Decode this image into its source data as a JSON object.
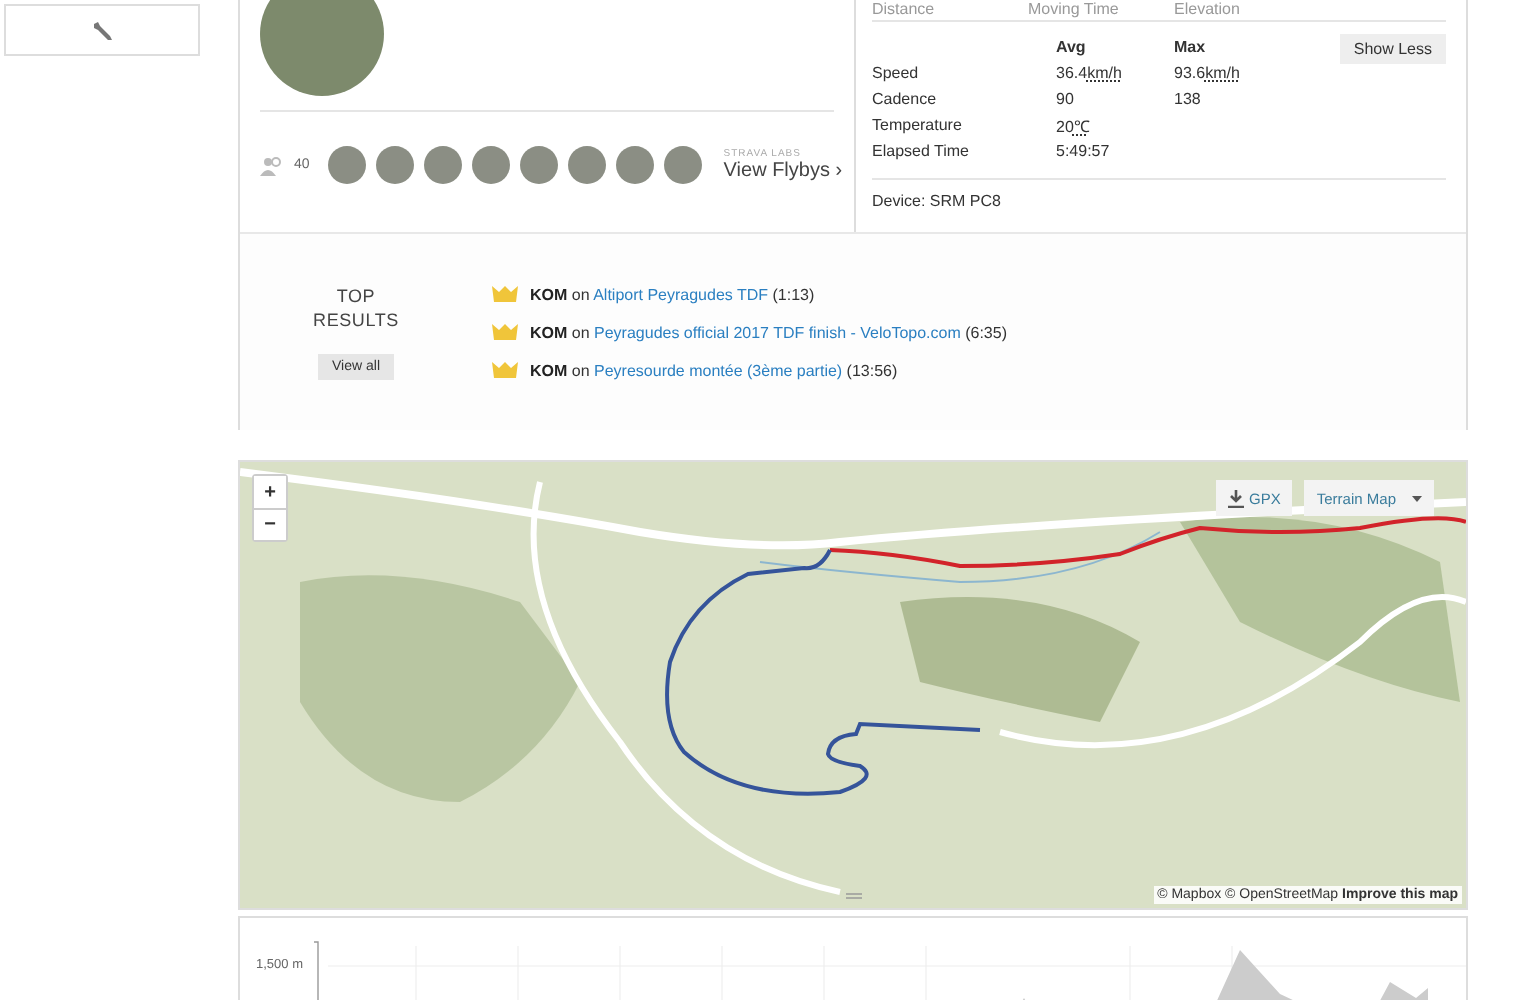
{
  "activity": {
    "athletes_count": "40",
    "labs_label": "STRAVA LABS",
    "flybys_link": "View Flybys",
    "flybys_chevron": "›"
  },
  "stats": {
    "summary_labels": [
      "Distance",
      "Moving Time",
      "Elevation"
    ],
    "columns": [
      "Avg",
      "Max"
    ],
    "rows": [
      {
        "label": "Speed",
        "avg": "36.4",
        "avg_unit": "km/h",
        "max": "93.6",
        "max_unit": "km/h"
      },
      {
        "label": "Cadence",
        "avg": "90",
        "avg_unit": "",
        "max": "138",
        "max_unit": ""
      },
      {
        "label": "Temperature",
        "avg": "20",
        "avg_unit": "℃",
        "max": "",
        "max_unit": ""
      },
      {
        "label": "Elapsed Time",
        "avg": "5:49:57",
        "avg_unit": "",
        "max": "",
        "max_unit": ""
      }
    ],
    "toggle_button": "Show Less",
    "device": "Device: SRM PC8"
  },
  "top_results": {
    "title_line1": "TOP",
    "title_line2": "RESULTS",
    "view_all": "View all",
    "items": [
      {
        "kind": "kom",
        "achievement": "KOM",
        "joiner": "on",
        "segment": "Altiport Peyragudes TDF",
        "time": "(1:13)"
      },
      {
        "kind": "kom",
        "achievement": "KOM",
        "joiner": "on",
        "segment": "Peyragudes official 2017 TDF finish - VeloTopo.com",
        "time": "(6:35)"
      },
      {
        "kind": "kom",
        "achievement": "KOM",
        "joiner": "on",
        "segment": "Peyresourde montée (3ème partie)",
        "time": "(13:56)"
      }
    ]
  },
  "map": {
    "zoom_in": "+",
    "zoom_out": "−",
    "gpx_button": "GPX",
    "map_type": "Terrain Map",
    "attribution": "© Mapbox © OpenStreetMap",
    "improve_link": "Improve this map"
  },
  "elevation": {
    "ytick_label": "1,500 m"
  }
}
